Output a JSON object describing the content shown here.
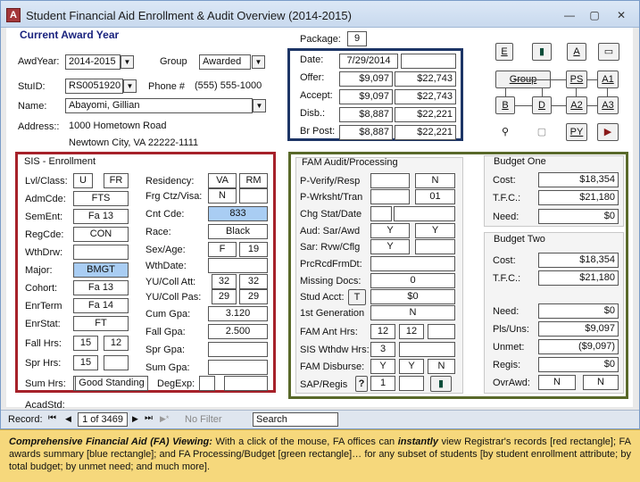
{
  "window": {
    "title": "Student Financial Aid Enrollment & Audit Overview (2014-2015)",
    "minimize": "—",
    "restore": "▢",
    "close": "✕",
    "app_icon": "A"
  },
  "header": {
    "section_title": "Current Award Year",
    "awdyear_label": "AwdYear:",
    "awdyear_value": "2014-2015",
    "group_label": "Group",
    "group_value": "Awarded",
    "stuid_label": "StuID:",
    "stuid_value": "RS0051920",
    "phone_label": "Phone #",
    "phone_value": "(555) 555-1000",
    "name_label": "Name:",
    "name_value": "Abayomi, Gillian",
    "address_label": "Address::",
    "address_line1": "1000 Hometown Road",
    "address_line2": "Newtown City, VA  22222-1111"
  },
  "package": {
    "label": "Package:",
    "value": "9"
  },
  "awards": {
    "date_label": "Date:",
    "date_value": "7/29/2014",
    "date_value2": "",
    "offer_label": "Offer:",
    "offer_1": "$9,097",
    "offer_2": "$22,743",
    "accept_label": "Accept:",
    "accept_1": "$9,097",
    "accept_2": "$22,743",
    "disb_label": "Disb.:",
    "disb_1": "$8,887",
    "disb_2": "$22,221",
    "brpost_label": "Br Post:",
    "brpost_1": "$8,887",
    "brpost_2": "$22,221"
  },
  "buttons": {
    "e": "E",
    "book": "▮",
    "a": "A",
    "card": "▭",
    "group": "Group",
    "ps": "PS",
    "a1": "A1",
    "b": "B",
    "d": "D",
    "a2": "A2",
    "a3": "A3",
    "filter": "⚲",
    "filter2": "▢",
    "py": "PY",
    "exit": "▶"
  },
  "sis": {
    "title": "SIS - Enrollment",
    "lvlclass_label": "Lvl/Class:",
    "lvl": "U",
    "cls": "FR",
    "admcde_label": "AdmCde:",
    "admcde": "FTS",
    "sement_label": "SemEnt:",
    "sement": "Fa 13",
    "regcde_label": "RegCde:",
    "regcde": "CON",
    "wthdrw_label": "WthDrw:",
    "wthdrw": "",
    "major_label": "Major:",
    "major": "BMGT",
    "cohort_label": "Cohort:",
    "cohort": "Fa 13",
    "enrterm_label": "EnrTerm",
    "enrterm": "Fa 14",
    "enrstat_label": "EnrStat:",
    "enrstat": "FT",
    "fallhrs_label": "Fall Hrs:",
    "fallhrs_1": "15",
    "fallhrs_2": "12",
    "sprhrs_label": "Spr Hrs:",
    "sprhrs_1": "15",
    "sprhrs_2": "",
    "sumhrs_label": "Sum Hrs:",
    "acadstd_label": "AcadStd:",
    "acadstd": "Good Standing",
    "residency_label": "Residency:",
    "res_1": "VA",
    "res_2": "RM",
    "frgctz_label": "Frg Ctz/Visa:",
    "frgctz": "N",
    "cntcde_label": "Cnt Cde:",
    "cntcde": "833",
    "race_label": "Race:",
    "race": "Black",
    "sexage_label": "Sex/Age:",
    "sex": "F",
    "age": "19",
    "wthdate_label": "WthDate:",
    "yucollatt_label": "YU/Coll Att:",
    "att_1": "32",
    "att_2": "32",
    "yucollpas_label": "YU/Coll Pas:",
    "pas_1": "29",
    "pas_2": "29",
    "cumgpa_label": "Cum Gpa:",
    "cumgpa": "3.120",
    "fallgpa_label": "Fall Gpa:",
    "fallgpa": "2.500",
    "sprgpa_label": "Spr Gpa:",
    "sumgpa_label": "Sum Gpa:",
    "degexp_label": "DegExp:"
  },
  "fam": {
    "title": "FAM Audit/Processing",
    "pverify_label": "P-Verify/Resp",
    "pverify_2": "N",
    "pwrksht_label": "P-Wrksht/Tran",
    "pwrksht_2": "01",
    "chgstat_label": "Chg Stat/Date",
    "aud_label": "Aud: Sar/Awd",
    "aud_1": "Y",
    "aud_2": "Y",
    "sar_label": "Sar: Rvw/Cflg",
    "sar_1": "Y",
    "prcrcd_label": "PrcRcdFrmDt:",
    "missing_label": "Missing Docs:",
    "missing": "0",
    "studacct_label": "Stud Acct:",
    "studacct_btn": "T",
    "studacct": "$0",
    "firstgen_label": "1st Generation",
    "firstgen": "N",
    "famant_label": "FAM Ant Hrs:",
    "famant_1": "12",
    "famant_2": "12",
    "siswthdw_label": "SIS Wthdw Hrs:",
    "siswthdw": "3",
    "famdisb_label": "FAM Disburse:",
    "famdisb_1": "Y",
    "famdisb_2": "Y",
    "famdisb_3": "N",
    "sap_label": "SAP/Regis",
    "sap_icon": "?",
    "sap": "1"
  },
  "budget1": {
    "title": "Budget One",
    "cost_label": "Cost:",
    "cost": "$18,354",
    "tfc_label": "T.F.C.:",
    "tfc": "$21,180",
    "need_label": "Need:",
    "need": "$0"
  },
  "budget2": {
    "title": "Budget Two",
    "cost_label": "Cost:",
    "cost": "$18,354",
    "tfc_label": "T.F.C.:",
    "tfc": "$21,180",
    "need_label": "Need:",
    "need": "$0",
    "plsuns_label": "Pls/Uns:",
    "plsuns": "$9,097",
    "unmet_label": "Unmet:",
    "unmet": "($9,097)",
    "regis_label": "Regis:",
    "regis": "$0",
    "ovrawd_label": "OvrAwd:",
    "ovr_1": "N",
    "ovr_2": "N"
  },
  "nav": {
    "record_label": "Record:",
    "first": "⏮",
    "prev": "◀",
    "current": "1 of 3469",
    "next": "▶",
    "last": "⏭",
    "new": "▶*",
    "nofilter": "No Filter",
    "search": "Search"
  },
  "caption": {
    "lead": "Comprehensive Financial Aid (FA) Viewing:",
    "t1": " With a click of the mouse, FA offices can ",
    "instantly": "instantly",
    "t2": " view Registrar's records [red rectangle]; FA awards summary [blue rectangle]; and FA Processing/Budget [green rectangle]… for any subset of students [by student enrollment attribute; by total budget; by unmet need; and much more]."
  }
}
